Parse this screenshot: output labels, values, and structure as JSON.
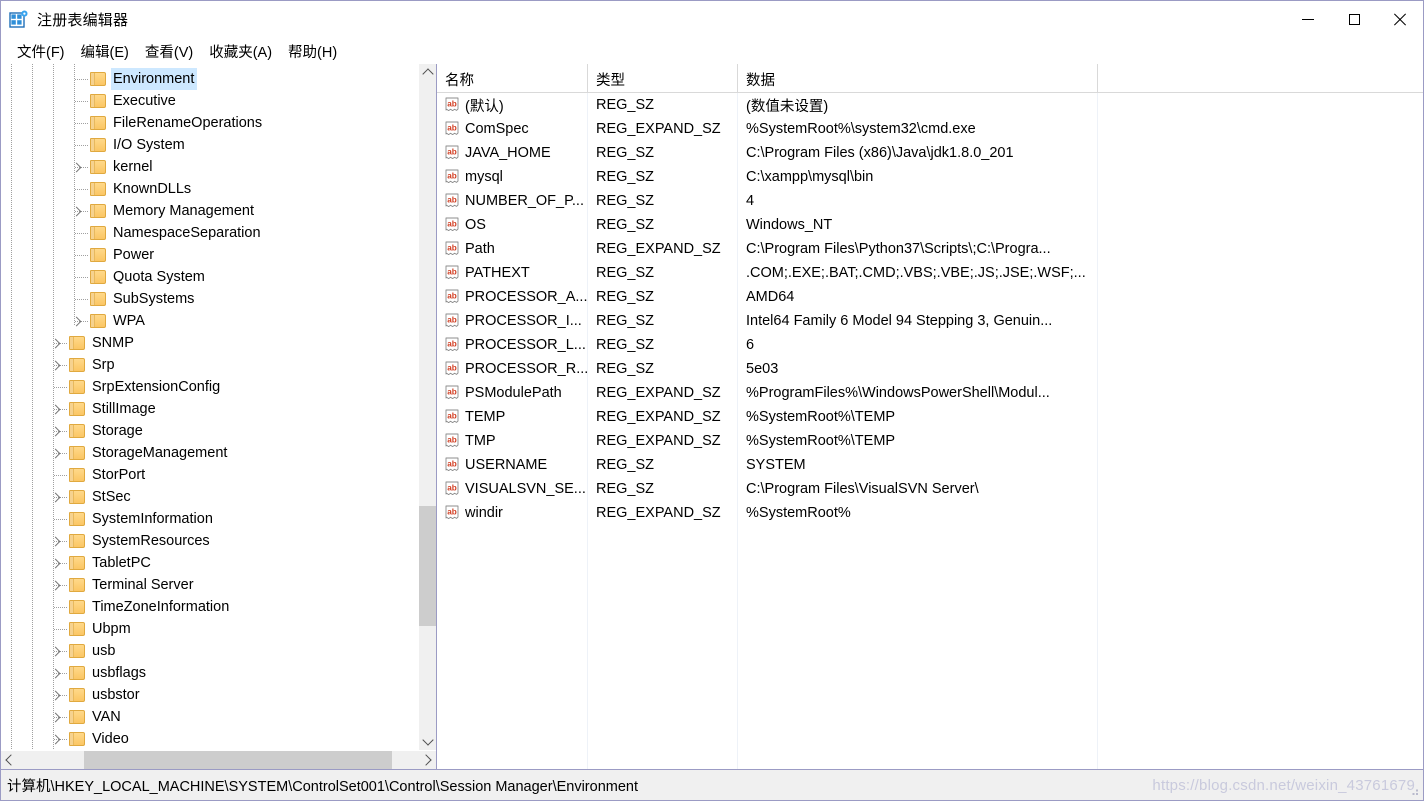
{
  "window": {
    "title": "注册表编辑器",
    "icon": "registry-editor-icon",
    "controls": {
      "minimize": "minimize-button",
      "maximize": "maximize-button",
      "close": "close-button"
    }
  },
  "menubar": {
    "items": [
      {
        "label": "文件(F)"
      },
      {
        "label": "编辑(E)"
      },
      {
        "label": "查看(V)"
      },
      {
        "label": "收藏夹(A)"
      },
      {
        "label": "帮助(H)"
      }
    ]
  },
  "tree": {
    "items": [
      {
        "label": "Environment",
        "depth": 4,
        "expandable": false,
        "selected": true
      },
      {
        "label": "Executive",
        "depth": 4,
        "expandable": false,
        "selected": false
      },
      {
        "label": "FileRenameOperations",
        "depth": 4,
        "expandable": false,
        "selected": false
      },
      {
        "label": "I/O System",
        "depth": 4,
        "expandable": false,
        "selected": false
      },
      {
        "label": "kernel",
        "depth": 4,
        "expandable": true,
        "selected": false
      },
      {
        "label": "KnownDLLs",
        "depth": 4,
        "expandable": false,
        "selected": false
      },
      {
        "label": "Memory Management",
        "depth": 4,
        "expandable": true,
        "selected": false
      },
      {
        "label": "NamespaceSeparation",
        "depth": 4,
        "expandable": false,
        "selected": false
      },
      {
        "label": "Power",
        "depth": 4,
        "expandable": false,
        "selected": false
      },
      {
        "label": "Quota System",
        "depth": 4,
        "expandable": false,
        "selected": false
      },
      {
        "label": "SubSystems",
        "depth": 4,
        "expandable": false,
        "selected": false
      },
      {
        "label": "WPA",
        "depth": 4,
        "expandable": true,
        "selected": false
      },
      {
        "label": "SNMP",
        "depth": 3,
        "expandable": true,
        "selected": false
      },
      {
        "label": "Srp",
        "depth": 3,
        "expandable": true,
        "selected": false
      },
      {
        "label": "SrpExtensionConfig",
        "depth": 3,
        "expandable": false,
        "selected": false
      },
      {
        "label": "StillImage",
        "depth": 3,
        "expandable": true,
        "selected": false
      },
      {
        "label": "Storage",
        "depth": 3,
        "expandable": true,
        "selected": false
      },
      {
        "label": "StorageManagement",
        "depth": 3,
        "expandable": true,
        "selected": false
      },
      {
        "label": "StorPort",
        "depth": 3,
        "expandable": false,
        "selected": false
      },
      {
        "label": "StSec",
        "depth": 3,
        "expandable": true,
        "selected": false
      },
      {
        "label": "SystemInformation",
        "depth": 3,
        "expandable": false,
        "selected": false
      },
      {
        "label": "SystemResources",
        "depth": 3,
        "expandable": true,
        "selected": false
      },
      {
        "label": "TabletPC",
        "depth": 3,
        "expandable": true,
        "selected": false
      },
      {
        "label": "Terminal Server",
        "depth": 3,
        "expandable": true,
        "selected": false
      },
      {
        "label": "TimeZoneInformation",
        "depth": 3,
        "expandable": false,
        "selected": false
      },
      {
        "label": "Ubpm",
        "depth": 3,
        "expandable": false,
        "selected": false
      },
      {
        "label": "usb",
        "depth": 3,
        "expandable": true,
        "selected": false
      },
      {
        "label": "usbflags",
        "depth": 3,
        "expandable": true,
        "selected": false
      },
      {
        "label": "usbstor",
        "depth": 3,
        "expandable": true,
        "selected": false
      },
      {
        "label": "VAN",
        "depth": 3,
        "expandable": true,
        "selected": false
      },
      {
        "label": "Video",
        "depth": 3,
        "expandable": true,
        "selected": false
      }
    ]
  },
  "list": {
    "columns": [
      {
        "key": "name",
        "label": "名称"
      },
      {
        "key": "type",
        "label": "类型"
      },
      {
        "key": "data",
        "label": "数据"
      }
    ],
    "rows": [
      {
        "name": "(默认)",
        "type": "REG_SZ",
        "data": "(数值未设置)",
        "icon": "string-value-icon"
      },
      {
        "name": "ComSpec",
        "type": "REG_EXPAND_SZ",
        "data": "%SystemRoot%\\system32\\cmd.exe",
        "icon": "string-value-icon"
      },
      {
        "name": "JAVA_HOME",
        "type": "REG_SZ",
        "data": "C:\\Program Files (x86)\\Java\\jdk1.8.0_201",
        "icon": "string-value-icon"
      },
      {
        "name": "mysql",
        "type": "REG_SZ",
        "data": "C:\\xampp\\mysql\\bin",
        "icon": "string-value-icon"
      },
      {
        "name": "NUMBER_OF_P...",
        "type": "REG_SZ",
        "data": "4",
        "icon": "string-value-icon"
      },
      {
        "name": "OS",
        "type": "REG_SZ",
        "data": "Windows_NT",
        "icon": "string-value-icon"
      },
      {
        "name": "Path",
        "type": "REG_EXPAND_SZ",
        "data": "C:\\Program Files\\Python37\\Scripts\\;C:\\Progra...",
        "icon": "string-value-icon"
      },
      {
        "name": "PATHEXT",
        "type": "REG_SZ",
        "data": ".COM;.EXE;.BAT;.CMD;.VBS;.VBE;.JS;.JSE;.WSF;...",
        "icon": "string-value-icon"
      },
      {
        "name": "PROCESSOR_A...",
        "type": "REG_SZ",
        "data": "AMD64",
        "icon": "string-value-icon"
      },
      {
        "name": "PROCESSOR_I...",
        "type": "REG_SZ",
        "data": "Intel64 Family 6 Model 94 Stepping 3, Genuin...",
        "icon": "string-value-icon"
      },
      {
        "name": "PROCESSOR_L...",
        "type": "REG_SZ",
        "data": "6",
        "icon": "string-value-icon"
      },
      {
        "name": "PROCESSOR_R...",
        "type": "REG_SZ",
        "data": "5e03",
        "icon": "string-value-icon"
      },
      {
        "name": "PSModulePath",
        "type": "REG_EXPAND_SZ",
        "data": "%ProgramFiles%\\WindowsPowerShell\\Modul...",
        "icon": "string-value-icon"
      },
      {
        "name": "TEMP",
        "type": "REG_EXPAND_SZ",
        "data": "%SystemRoot%\\TEMP",
        "icon": "string-value-icon"
      },
      {
        "name": "TMP",
        "type": "REG_EXPAND_SZ",
        "data": "%SystemRoot%\\TEMP",
        "icon": "string-value-icon"
      },
      {
        "name": "USERNAME",
        "type": "REG_SZ",
        "data": "SYSTEM",
        "icon": "string-value-icon"
      },
      {
        "name": "VISUALSVN_SE...",
        "type": "REG_SZ",
        "data": "C:\\Program Files\\VisualSVN Server\\",
        "icon": "string-value-icon"
      },
      {
        "name": "windir",
        "type": "REG_EXPAND_SZ",
        "data": "%SystemRoot%",
        "icon": "string-value-icon"
      }
    ]
  },
  "statusbar": {
    "path": "计算机\\HKEY_LOCAL_MACHINE\\SYSTEM\\ControlSet001\\Control\\Session Manager\\Environment"
  },
  "watermark": {
    "text": "https://blog.csdn.net/weixin_43761679"
  },
  "colors": {
    "selection": "#cde8ff",
    "window_border": "#9b9bc4",
    "folder": "#fbc664",
    "value_icon_text": "#d13b1f",
    "scrollbar_thumb": "#cdcdcd",
    "statusbar_bg": "#f0f0f0"
  }
}
